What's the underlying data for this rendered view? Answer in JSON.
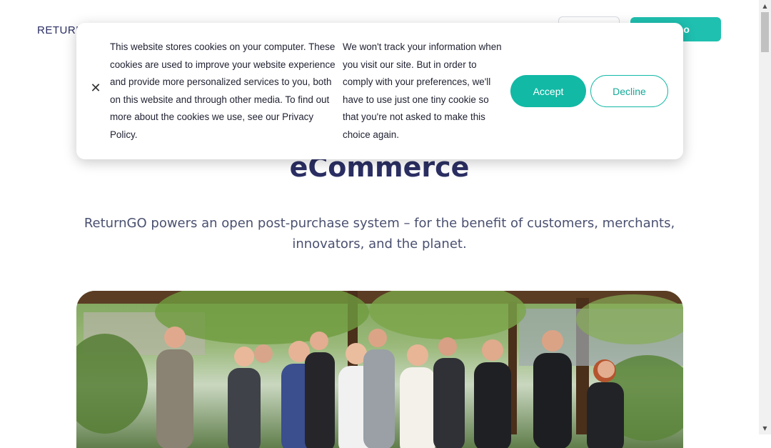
{
  "header": {
    "logo_text": "RETURN",
    "login_label": "",
    "demo_label": "Demo"
  },
  "hero": {
    "title": "eCommerce",
    "subtitle": "ReturnGO powers an open post-purchase system – for the benefit of customers, merchants, innovators, and the planet."
  },
  "cookie_banner": {
    "close_icon": "close-icon",
    "text_col1": "This website stores cookies on your computer. These cookies are used to improve your website experience and provide more personalized services to you, both on this website and through other media. To find out more about the cookies we use, see our Privacy Policy.",
    "text_col2": "We won't track your information when you visit our site. But in order to comply with your preferences, we'll have to use just one tiny cookie so that you're not asked to make this choice again.",
    "accept_label": "Accept",
    "decline_label": "Decline"
  },
  "colors": {
    "accent": "#12b9a5",
    "title": "#2b2f63"
  }
}
